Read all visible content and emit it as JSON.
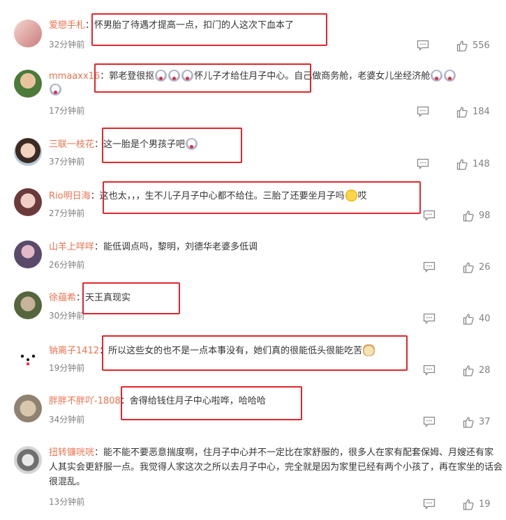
{
  "comments": [
    {
      "name": "爱戀手札",
      "colon": "：",
      "text": "怀男胎了待遇才提高一点，扣门的人这次下血本了",
      "time": "32分钟前",
      "likes": "556"
    },
    {
      "name": "mmaaxx16",
      "colon": "：",
      "text_a": "郭老登很抠",
      "text_b": "怀儿子才给住月子中心。自己做商务舱，老婆女儿坐经济舱",
      "time": "17分钟前",
      "likes": "184"
    },
    {
      "name": "三联一枝花",
      "colon": "：",
      "text": "这一胎是个男孩子吧",
      "time": "37分钟前",
      "likes": "148"
    },
    {
      "name": "Rio明日海",
      "colon": "：",
      "text": "这也太，，，生不儿子月子中心都不给住。三胎了还要坐月子吗",
      "text_end": "哎",
      "time": "27分钟前",
      "likes": "98"
    },
    {
      "name": "山羊上咩咩",
      "colon": "：",
      "text": "能低调点吗，黎明，刘德华老婆多低调",
      "time": "26分钟前",
      "likes": "26"
    },
    {
      "name": "徐蕴希",
      "colon": "：",
      "text": "天王真现实",
      "time": "30分钟前",
      "likes": "40"
    },
    {
      "name": "钠离子1412",
      "colon": "：",
      "text": "所以这些女的也不是一点本事没有，她们真的很能低头很能吃苦",
      "time": "19分钟前",
      "likes": "28"
    },
    {
      "name": "胖胖不胖吖-1808",
      "colon": "：",
      "text": "舍得给钱住月子中心啦哗，哈哈哈",
      "time": "34分钟前",
      "likes": "37"
    },
    {
      "name": "扭转镰咣咣",
      "colon": "：",
      "text": "能不能不要恶意揣度啊，住月子中心并不一定比在家舒服的，很多人在家有配套保姆、月嫂还有家人其实会更舒服一点。我觉得人家这次之所以去月子中心，完全就是因为家里已经有两个小孩了，再在家坐的话会很混乱。",
      "time": "13分钟前",
      "likes": "19"
    }
  ],
  "colors": {
    "name": "#eb7350",
    "highlight": "#e0262d",
    "meta": "#808080"
  }
}
